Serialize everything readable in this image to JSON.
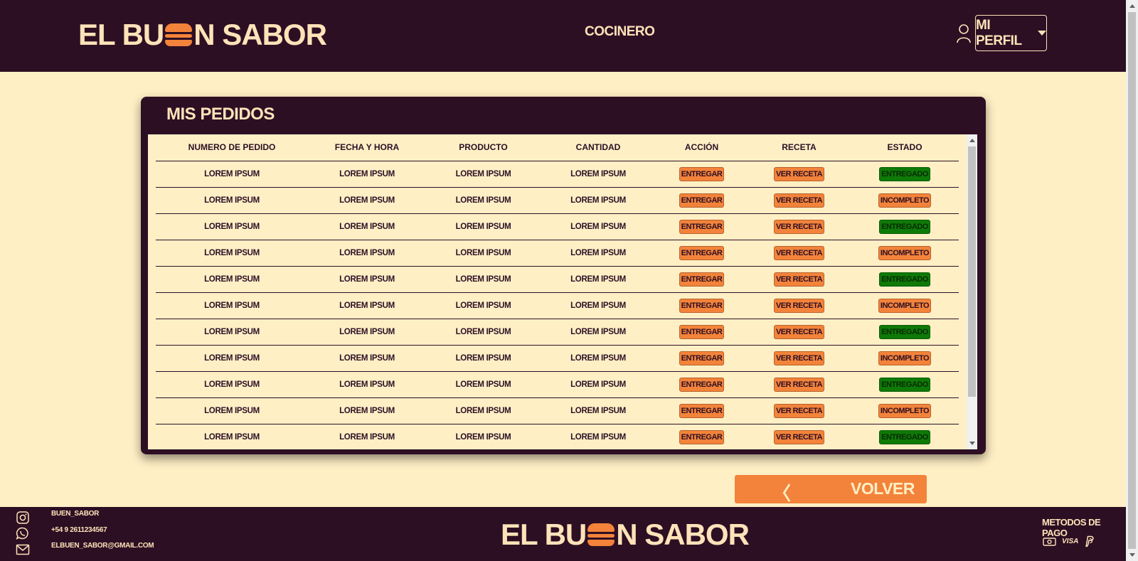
{
  "header": {
    "logo_left": "EL BU",
    "logo_right": "N SABOR",
    "role": "COCINERO",
    "profile_label": "MI PERFIL"
  },
  "orders": {
    "title": "MIS PEDIDOS",
    "columns": [
      "NUMERO DE PEDIDO",
      "FECHA Y HORA",
      "PRODUCTO",
      "CANTIDAD",
      "ACCIÓN",
      "RECETA",
      "ESTADO"
    ],
    "rows": [
      {
        "numero": "LOREM IPSUM",
        "fecha": "LOREM IPSUM",
        "producto": "LOREM IPSUM",
        "cantidad": "LOREM IPSUM",
        "accion": "ENTREGAR",
        "receta": "VER RECETA",
        "estado": "ENTREGADO"
      },
      {
        "numero": "LOREM IPSUM",
        "fecha": "LOREM IPSUM",
        "producto": "LOREM IPSUM",
        "cantidad": "LOREM IPSUM",
        "accion": "ENTREGAR",
        "receta": "VER RECETA",
        "estado": "INCOMPLETO"
      },
      {
        "numero": "LOREM IPSUM",
        "fecha": "LOREM IPSUM",
        "producto": "LOREM IPSUM",
        "cantidad": "LOREM IPSUM",
        "accion": "ENTREGAR",
        "receta": "VER RECETA",
        "estado": "ENTREGADO"
      },
      {
        "numero": "LOREM IPSUM",
        "fecha": "LOREM IPSUM",
        "producto": "LOREM IPSUM",
        "cantidad": "LOREM IPSUM",
        "accion": "ENTREGAR",
        "receta": "VER RECETA",
        "estado": "INCOMPLETO"
      },
      {
        "numero": "LOREM IPSUM",
        "fecha": "LOREM IPSUM",
        "producto": "LOREM IPSUM",
        "cantidad": "LOREM IPSUM",
        "accion": "ENTREGAR",
        "receta": "VER RECETA",
        "estado": "ENTREGADO"
      },
      {
        "numero": "LOREM IPSUM",
        "fecha": "LOREM IPSUM",
        "producto": "LOREM IPSUM",
        "cantidad": "LOREM IPSUM",
        "accion": "ENTREGAR",
        "receta": "VER RECETA",
        "estado": "INCOMPLETO"
      },
      {
        "numero": "LOREM IPSUM",
        "fecha": "LOREM IPSUM",
        "producto": "LOREM IPSUM",
        "cantidad": "LOREM IPSUM",
        "accion": "ENTREGAR",
        "receta": "VER RECETA",
        "estado": "ENTREGADO"
      },
      {
        "numero": "LOREM IPSUM",
        "fecha": "LOREM IPSUM",
        "producto": "LOREM IPSUM",
        "cantidad": "LOREM IPSUM",
        "accion": "ENTREGAR",
        "receta": "VER RECETA",
        "estado": "INCOMPLETO"
      },
      {
        "numero": "LOREM IPSUM",
        "fecha": "LOREM IPSUM",
        "producto": "LOREM IPSUM",
        "cantidad": "LOREM IPSUM",
        "accion": "ENTREGAR",
        "receta": "VER RECETA",
        "estado": "ENTREGADO"
      },
      {
        "numero": "LOREM IPSUM",
        "fecha": "LOREM IPSUM",
        "producto": "LOREM IPSUM",
        "cantidad": "LOREM IPSUM",
        "accion": "ENTREGAR",
        "receta": "VER RECETA",
        "estado": "INCOMPLETO"
      },
      {
        "numero": "LOREM IPSUM",
        "fecha": "LOREM IPSUM",
        "producto": "LOREM IPSUM",
        "cantidad": "LOREM IPSUM",
        "accion": "ENTREGAR",
        "receta": "VER RECETA",
        "estado": "ENTREGADO"
      },
      {
        "numero": "",
        "fecha": "",
        "producto": "",
        "cantidad": "",
        "accion": "",
        "receta": "",
        "estado": ""
      }
    ]
  },
  "volver": {
    "chevron": "〈",
    "label": "VOLVER"
  },
  "footer": {
    "instagram": "BUEN_SABOR",
    "phone": "+54 9 2611234567",
    "email": "ELBUEN_SABOR@GMAIL.COM",
    "logo_left": "EL BU",
    "logo_right": "N SABOR",
    "payment_title": "METODOS DE PAGO",
    "visa_label": "VISA"
  },
  "icons": {
    "user": "user-icon",
    "caret": "chevron-down-icon",
    "instagram": "instagram-icon",
    "whatsapp": "whatsapp-icon",
    "mail": "mail-icon",
    "cash": "cash-icon",
    "paypal": "paypal-icon"
  },
  "colors": {
    "brand_dark": "#2D0F24",
    "background": "#FFEFC5",
    "accent_orange": "#F3833A",
    "text_light": "#FFE3B8",
    "delivered_green": "#0E7A07"
  }
}
